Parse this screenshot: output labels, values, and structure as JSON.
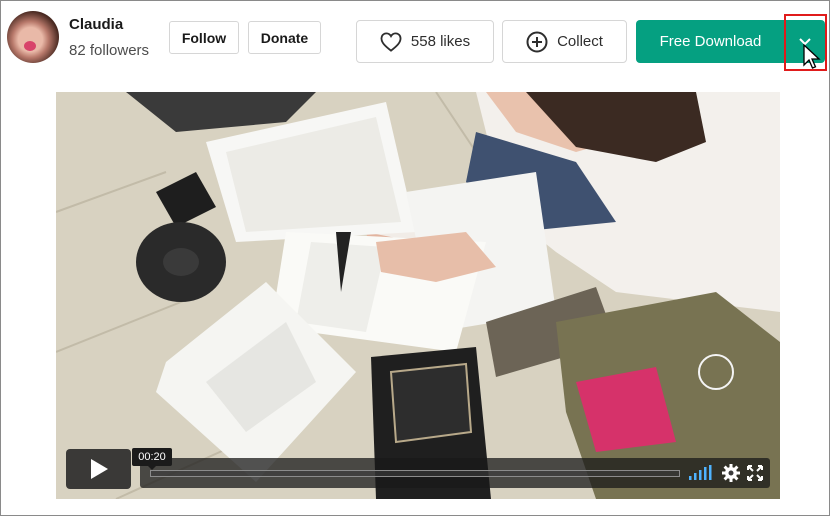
{
  "creator": {
    "name": "Claudia",
    "followers": "82 followers"
  },
  "actions": {
    "follow_label": "Follow",
    "donate_label": "Donate",
    "likes_label": "558 likes",
    "collect_label": "Collect",
    "download_label": "Free Download"
  },
  "icons": {
    "likes": "heart-icon",
    "collect": "plus-circle-icon",
    "dropdown": "chevron-down-icon",
    "play": "play-icon",
    "volume": "volume-icon",
    "settings": "gear-icon",
    "fullscreen": "fullscreen-icon"
  },
  "player": {
    "current_time": "00:20"
  },
  "colors": {
    "accent": "#05a081",
    "highlight": "#e01b1b"
  }
}
